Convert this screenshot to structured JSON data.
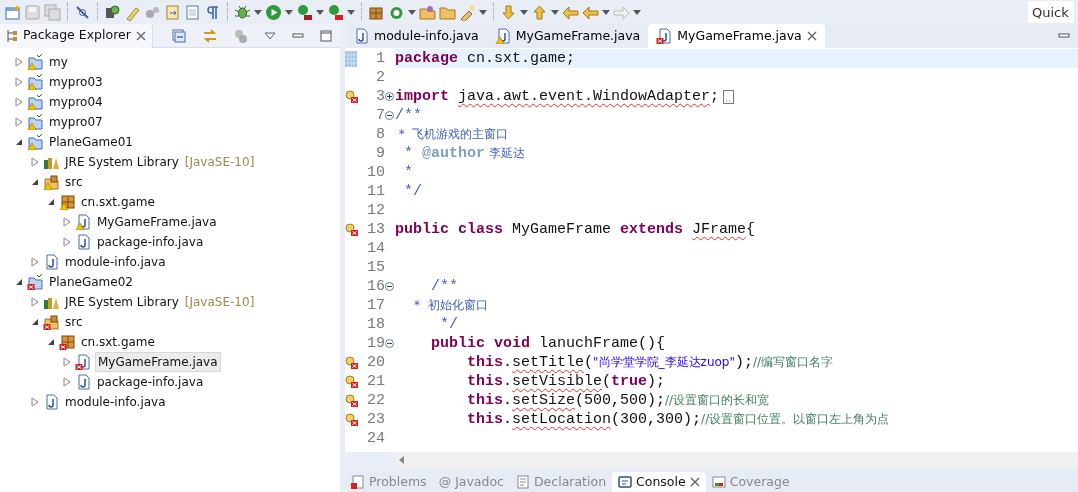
{
  "toolbar": {
    "quick_access": {
      "placeholder": "Quick"
    }
  },
  "explorer": {
    "title": "Package Explorer",
    "tree": [
      {
        "label": "my",
        "kind": "project",
        "warning": true,
        "error": false,
        "expanded": false,
        "selected": false
      },
      {
        "label": "mypro03",
        "kind": "project",
        "warning": true,
        "error": false,
        "expanded": false,
        "selected": false
      },
      {
        "label": "mypro04",
        "kind": "project",
        "warning": true,
        "error": false,
        "expanded": false,
        "selected": false
      },
      {
        "label": "mypro07",
        "kind": "project",
        "warning": true,
        "error": false,
        "expanded": false,
        "selected": false
      },
      {
        "label": "PlaneGame01",
        "kind": "project",
        "warning": true,
        "error": false,
        "expanded": true,
        "selected": false,
        "children": [
          {
            "label": "JRE System Library",
            "decoration": "[JavaSE-10]",
            "kind": "library",
            "warning": false,
            "error": false,
            "expanded": false,
            "selected": false
          },
          {
            "label": "src",
            "kind": "src",
            "warning": true,
            "error": false,
            "expanded": true,
            "selected": false,
            "children": [
              {
                "label": "cn.sxt.game",
                "kind": "package",
                "warning": true,
                "error": false,
                "expanded": true,
                "selected": false,
                "children": [
                  {
                    "label": "MyGameFrame.java",
                    "kind": "file",
                    "warning": true,
                    "error": false,
                    "expanded": false,
                    "selected": false
                  },
                  {
                    "label": "package-info.java",
                    "kind": "file",
                    "warning": false,
                    "error": false,
                    "expanded": false,
                    "selected": false
                  }
                ]
              }
            ]
          },
          {
            "label": "module-info.java",
            "kind": "file",
            "warning": false,
            "error": false,
            "expanded": false,
            "selected": false
          }
        ]
      },
      {
        "label": "PlaneGame02",
        "kind": "project",
        "warning": false,
        "error": true,
        "expanded": true,
        "selected": false,
        "children": [
          {
            "label": "JRE System Library",
            "decoration": "[JavaSE-10]",
            "kind": "library",
            "warning": false,
            "error": false,
            "expanded": false,
            "selected": false
          },
          {
            "label": "src",
            "kind": "src",
            "warning": false,
            "error": true,
            "expanded": true,
            "selected": false,
            "children": [
              {
                "label": "cn.sxt.game",
                "kind": "package",
                "warning": false,
                "error": true,
                "expanded": true,
                "selected": false,
                "children": [
                  {
                    "label": "MyGameFrame.java",
                    "kind": "file",
                    "warning": false,
                    "error": true,
                    "expanded": false,
                    "selected": true
                  },
                  {
                    "label": "package-info.java",
                    "kind": "file",
                    "warning": false,
                    "error": false,
                    "expanded": false,
                    "selected": false
                  }
                ]
              }
            ]
          },
          {
            "label": "module-info.java",
            "kind": "file",
            "warning": false,
            "error": false,
            "expanded": false,
            "selected": false
          }
        ]
      }
    ]
  },
  "editor": {
    "tabs": [
      {
        "label": "module-info.java",
        "warning": false,
        "error": false,
        "selected": false
      },
      {
        "label": "MyGameFrame.java",
        "warning": true,
        "error": false,
        "selected": false
      },
      {
        "label": "MyGameFrame.java",
        "warning": false,
        "error": true,
        "selected": true
      }
    ],
    "lines": [
      {
        "number": "1",
        "current": true,
        "error": false,
        "tokens": [
          {
            "kind": "keyword",
            "text": "package"
          },
          {
            "kind": "text",
            "text": " cn.sxt.game;"
          }
        ]
      },
      {
        "number": "2",
        "current": false,
        "error": false
      },
      {
        "number": "3",
        "current": false,
        "error": true,
        "foldable": true,
        "collapsed": true,
        "tokens": [
          {
            "kind": "keyword",
            "text": "import "
          },
          {
            "kind": "squiggle",
            "text": "java.awt.event.WindowAdapter"
          },
          {
            "kind": "text",
            "text": ";"
          }
        ]
      },
      {
        "number": "7",
        "current": false,
        "error": false,
        "foldable": true,
        "collapsed": false,
        "tokens": [
          {
            "kind": "javadoc",
            "text": "/**"
          }
        ]
      },
      {
        "number": "8",
        "current": false,
        "error": false,
        "tokens": [
          {
            "kind": "javadoc",
            "text": " *  飞机游戏的主窗口"
          }
        ]
      },
      {
        "number": "9",
        "current": false,
        "error": false,
        "tokens": [
          {
            "kind": "javadoc",
            "text": " * "
          },
          {
            "kind": "doc-tag",
            "text": "@author"
          },
          {
            "kind": "javadoc",
            "text": " 李延达"
          }
        ]
      },
      {
        "number": "10",
        "current": false,
        "error": false,
        "tokens": [
          {
            "kind": "javadoc",
            "text": " *"
          }
        ]
      },
      {
        "number": "11",
        "current": false,
        "error": false,
        "tokens": [
          {
            "kind": "javadoc",
            "text": " */"
          }
        ]
      },
      {
        "number": "12",
        "current": false,
        "error": false
      },
      {
        "number": "13",
        "current": false,
        "error": true,
        "tokens": [
          {
            "kind": "keyword",
            "text": "public class"
          },
          {
            "kind": "text",
            "text": " MyGameFrame "
          },
          {
            "kind": "keyword",
            "text": "extends "
          },
          {
            "kind": "squiggle",
            "text": "JFrame"
          },
          {
            "kind": "text",
            "text": "{"
          }
        ]
      },
      {
        "number": "14",
        "current": false,
        "error": false
      },
      {
        "number": "15",
        "current": false,
        "error": false
      },
      {
        "number": "16",
        "current": false,
        "error": false,
        "foldable": true,
        "collapsed": false,
        "tokens": [
          {
            "kind": "javadoc",
            "text": "    /**"
          }
        ]
      },
      {
        "number": "17",
        "current": false,
        "error": false,
        "tokens": [
          {
            "kind": "javadoc",
            "text": "     *  初始化窗口"
          }
        ]
      },
      {
        "number": "18",
        "current": false,
        "error": false,
        "tokens": [
          {
            "kind": "javadoc",
            "text": "     */"
          }
        ]
      },
      {
        "number": "19",
        "current": false,
        "error": false,
        "foldable": true,
        "collapsed": false,
        "tokens": [
          {
            "kind": "keyword",
            "text": "    public void"
          },
          {
            "kind": "text",
            "text": " lanuchFrame(){"
          }
        ]
      },
      {
        "number": "20",
        "current": false,
        "error": true,
        "tokens": [
          {
            "kind": "keyword",
            "text": "        this"
          },
          {
            "kind": "text",
            "text": "."
          },
          {
            "kind": "squiggle",
            "text": "setTitle"
          },
          {
            "kind": "text",
            "text": "("
          },
          {
            "kind": "string",
            "text": "\"尚学堂学院_李延达zuop\""
          },
          {
            "kind": "text",
            "text": ");"
          },
          {
            "kind": "comment",
            "text": "//编写窗口名字"
          }
        ]
      },
      {
        "number": "21",
        "current": false,
        "error": true,
        "tokens": [
          {
            "kind": "keyword",
            "text": "        this"
          },
          {
            "kind": "text",
            "text": "."
          },
          {
            "kind": "squiggle",
            "text": "setVisible"
          },
          {
            "kind": "text",
            "text": "("
          },
          {
            "kind": "keyword",
            "text": "true"
          },
          {
            "kind": "text",
            "text": ");"
          }
        ]
      },
      {
        "number": "22",
        "current": false,
        "error": true,
        "tokens": [
          {
            "kind": "keyword",
            "text": "        this"
          },
          {
            "kind": "text",
            "text": "."
          },
          {
            "kind": "squiggle",
            "text": "setSize"
          },
          {
            "kind": "text",
            "text": "(500,500);"
          },
          {
            "kind": "comment",
            "text": "//设置窗口的长和宽"
          }
        ]
      },
      {
        "number": "23",
        "current": false,
        "error": true,
        "tokens": [
          {
            "kind": "keyword",
            "text": "        this"
          },
          {
            "kind": "text",
            "text": "."
          },
          {
            "kind": "squiggle",
            "text": "setLocation"
          },
          {
            "kind": "text",
            "text": "(300,300);"
          },
          {
            "kind": "comment",
            "text": "//设置窗口位置。以窗口左上角为点"
          }
        ]
      },
      {
        "number": "24",
        "current": false,
        "error": false
      }
    ]
  },
  "bottom_tabs": [
    {
      "label": "Problems",
      "kind": "problems",
      "selected": false
    },
    {
      "label": "Javadoc",
      "kind": "javadoc",
      "glyph": "@",
      "selected": false
    },
    {
      "label": "Declaration",
      "kind": "declaration",
      "selected": false
    },
    {
      "label": "Console",
      "kind": "console",
      "selected": true
    },
    {
      "label": "Coverage",
      "kind": "coverage",
      "selected": false
    }
  ]
}
